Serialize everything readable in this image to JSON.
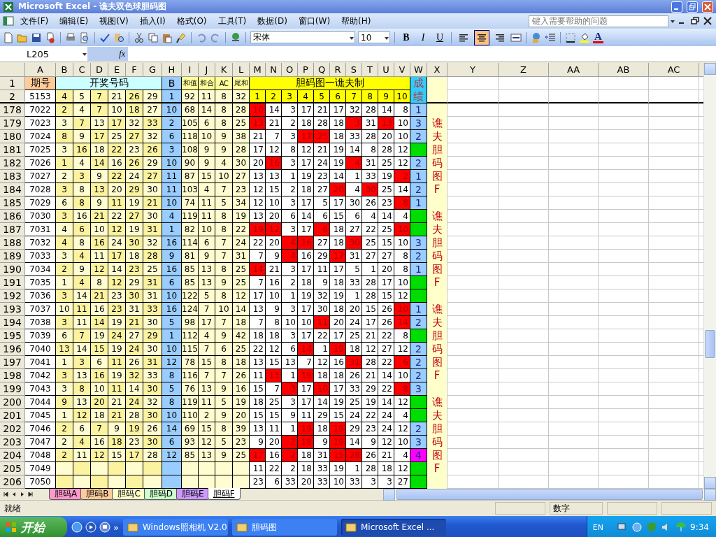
{
  "window": {
    "title": "Microsoft Excel - 谯夫双色球胆码图"
  },
  "menus": [
    "文件(F)",
    "编辑(E)",
    "视图(V)",
    "插入(I)",
    "格式(O)",
    "工具(T)",
    "数据(D)",
    "窗口(W)",
    "帮助(H)"
  ],
  "help_box": {
    "placeholder": "键入需要帮助的问题"
  },
  "formatting": {
    "font": "宋体",
    "size": "10",
    "bold": "B",
    "italic": "I",
    "underline": "U",
    "font_color": "A",
    "alignment": [
      {
        "kind": "left",
        "selected": false
      },
      {
        "kind": "center",
        "selected": true
      },
      {
        "kind": "right",
        "selected": false
      }
    ]
  },
  "formula_bar": {
    "name_box": "L205",
    "fx": "fx"
  },
  "columns": [
    "A",
    "B",
    "C",
    "D",
    "E",
    "F",
    "G",
    "H",
    "I",
    "J",
    "K",
    "L",
    "M",
    "N",
    "O",
    "P",
    "Q",
    "R",
    "S",
    "T",
    "U",
    "V",
    "W",
    "X",
    "Y",
    "Z",
    "AA",
    "AB",
    "AC"
  ],
  "header": {
    "row": "1",
    "period": "期号",
    "numbers": "开奖号码",
    "blue": "B",
    "stats": [
      "和值",
      "和合",
      "AC",
      "尾和"
    ],
    "grid_title": "胆码图一谯夫制",
    "score": "成绩"
  },
  "first_row": {
    "row": "2",
    "period": "5153",
    "balls": [
      "4",
      "5",
      "7",
      "21",
      "26",
      "29"
    ],
    "blue": "1",
    "stats": [
      "92",
      "11",
      "8",
      "32"
    ],
    "grid": [
      "1",
      "2",
      "3",
      "4",
      "5",
      "6",
      "7",
      "8",
      "9",
      "10"
    ]
  },
  "rows": [
    {
      "row": "178",
      "period": "7022",
      "balls": [
        "2",
        "4",
        "7",
        "10",
        "18",
        "27"
      ],
      "blue": "10",
      "stats": [
        "68",
        "14",
        "8",
        "28"
      ],
      "grid": [
        {
          "value": "10",
          "hit": true
        },
        {
          "value": "14",
          "hit": false
        },
        {
          "value": "3",
          "hit": false
        },
        {
          "value": "17",
          "hit": false
        },
        {
          "value": "21",
          "hit": false
        },
        {
          "value": "17",
          "hit": false
        },
        {
          "value": "32",
          "hit": false
        },
        {
          "value": "28",
          "hit": false
        },
        {
          "value": "14",
          "hit": false
        },
        {
          "value": "8",
          "hit": false
        }
      ],
      "score": "1",
      "color": "#99ccff"
    },
    {
      "row": "179",
      "period": "7023",
      "balls": [
        "3",
        "7",
        "13",
        "17",
        "32",
        "33"
      ],
      "blue": "2",
      "stats": [
        "105",
        "6",
        "8",
        "25"
      ],
      "grid": [
        {
          "value": "13",
          "hit": true
        },
        {
          "value": "21",
          "hit": false
        },
        {
          "value": "2",
          "hit": false
        },
        {
          "value": "18",
          "hit": false
        },
        {
          "value": "28",
          "hit": false
        },
        {
          "value": "18",
          "hit": false
        },
        {
          "value": "3",
          "hit": true
        },
        {
          "value": "31",
          "hit": false
        },
        {
          "value": "13",
          "hit": true
        },
        {
          "value": "10",
          "hit": false
        }
      ],
      "score": "3",
      "color": "#99ccff",
      "note": "谯夫胆码图F"
    },
    {
      "row": "180",
      "period": "7024",
      "balls": [
        "8",
        "9",
        "17",
        "25",
        "27",
        "32"
      ],
      "blue": "6",
      "stats": [
        "118",
        "10",
        "9",
        "38"
      ],
      "grid": [
        {
          "value": "21",
          "hit": false
        },
        {
          "value": "7",
          "hit": false
        },
        {
          "value": "3",
          "hit": false
        },
        {
          "value": "17",
          "hit": true
        },
        {
          "value": "25",
          "hit": true
        },
        {
          "value": "18",
          "hit": false
        },
        {
          "value": "33",
          "hit": false
        },
        {
          "value": "28",
          "hit": false
        },
        {
          "value": "20",
          "hit": false
        },
        {
          "value": "10",
          "hit": false
        }
      ],
      "score": "2",
      "color": "#99ccff"
    },
    {
      "row": "181",
      "period": "7025",
      "balls": [
        "3",
        "16",
        "18",
        "22",
        "23",
        "26"
      ],
      "blue": "3",
      "stats": [
        "108",
        "9",
        "9",
        "28"
      ],
      "grid": [
        {
          "value": "17",
          "hit": false
        },
        {
          "value": "12",
          "hit": false
        },
        {
          "value": "8",
          "hit": false
        },
        {
          "value": "12",
          "hit": false
        },
        {
          "value": "21",
          "hit": false
        },
        {
          "value": "19",
          "hit": false
        },
        {
          "value": "14",
          "hit": false
        },
        {
          "value": "8",
          "hit": false
        },
        {
          "value": "28",
          "hit": false
        },
        {
          "value": "12",
          "hit": false
        }
      ],
      "color": "#00dd00"
    },
    {
      "row": "182",
      "period": "7026",
      "balls": [
        "1",
        "4",
        "14",
        "16",
        "26",
        "29"
      ],
      "blue": "10",
      "stats": [
        "90",
        "9",
        "4",
        "30"
      ],
      "grid": [
        {
          "value": "20",
          "hit": false
        },
        {
          "value": "16",
          "hit": true
        },
        {
          "value": "3",
          "hit": false
        },
        {
          "value": "17",
          "hit": false
        },
        {
          "value": "24",
          "hit": false
        },
        {
          "value": "19",
          "hit": false
        },
        {
          "value": "4",
          "hit": true
        },
        {
          "value": "31",
          "hit": false
        },
        {
          "value": "25",
          "hit": false
        },
        {
          "value": "12",
          "hit": false
        }
      ],
      "score": "2",
      "color": "#99ccff"
    },
    {
      "row": "183",
      "period": "7027",
      "balls": [
        "2",
        "3",
        "9",
        "22",
        "24",
        "27"
      ],
      "blue": "11",
      "stats": [
        "87",
        "15",
        "10",
        "27"
      ],
      "grid": [
        {
          "value": "13",
          "hit": false
        },
        {
          "value": "13",
          "hit": false
        },
        {
          "value": "1",
          "hit": false
        },
        {
          "value": "19",
          "hit": false
        },
        {
          "value": "23",
          "hit": false
        },
        {
          "value": "14",
          "hit": false
        },
        {
          "value": "1",
          "hit": false
        },
        {
          "value": "33",
          "hit": false
        },
        {
          "value": "19",
          "hit": false
        },
        {
          "value": "2",
          "hit": true
        }
      ],
      "score": "1",
      "color": "#99ccff"
    },
    {
      "row": "184",
      "period": "7028",
      "balls": [
        "3",
        "8",
        "13",
        "20",
        "29",
        "30"
      ],
      "blue": "11",
      "stats": [
        "103",
        "4",
        "7",
        "23"
      ],
      "grid": [
        {
          "value": "12",
          "hit": false
        },
        {
          "value": "15",
          "hit": false
        },
        {
          "value": "2",
          "hit": false
        },
        {
          "value": "18",
          "hit": false
        },
        {
          "value": "27",
          "hit": false
        },
        {
          "value": "20",
          "hit": true
        },
        {
          "value": "4",
          "hit": false
        },
        {
          "value": "30",
          "hit": true
        },
        {
          "value": "25",
          "hit": false
        },
        {
          "value": "14",
          "hit": false
        }
      ],
      "score": "2",
      "color": "#99ccff"
    },
    {
      "row": "185",
      "period": "7029",
      "balls": [
        "6",
        "8",
        "9",
        "11",
        "19",
        "21"
      ],
      "blue": "10",
      "stats": [
        "74",
        "11",
        "5",
        "34"
      ],
      "grid": [
        {
          "value": "12",
          "hit": false
        },
        {
          "value": "10",
          "hit": false
        },
        {
          "value": "3",
          "hit": false
        },
        {
          "value": "17",
          "hit": false
        },
        {
          "value": "5",
          "hit": false
        },
        {
          "value": "17",
          "hit": false
        },
        {
          "value": "30",
          "hit": false
        },
        {
          "value": "26",
          "hit": false
        },
        {
          "value": "23",
          "hit": false
        },
        {
          "value": "8",
          "hit": true
        }
      ],
      "score": "1",
      "color": "#99ccff"
    },
    {
      "row": "186",
      "period": "7030",
      "balls": [
        "3",
        "16",
        "21",
        "22",
        "27",
        "30"
      ],
      "blue": "4",
      "stats": [
        "119",
        "11",
        "8",
        "19"
      ],
      "grid": [
        {
          "value": "13",
          "hit": false
        },
        {
          "value": "20",
          "hit": false
        },
        {
          "value": "6",
          "hit": false
        },
        {
          "value": "14",
          "hit": false
        },
        {
          "value": "6",
          "hit": false
        },
        {
          "value": "15",
          "hit": false
        },
        {
          "value": "6",
          "hit": false
        },
        {
          "value": "4",
          "hit": false
        },
        {
          "value": "14",
          "hit": false
        },
        {
          "value": "4",
          "hit": false
        }
      ],
      "color": "#00dd00",
      "note": "谯夫胆码图F"
    },
    {
      "row": "187",
      "period": "7031",
      "balls": [
        "4",
        "6",
        "10",
        "12",
        "19",
        "31"
      ],
      "blue": "1",
      "stats": [
        "82",
        "10",
        "8",
        "22"
      ],
      "grid": [
        {
          "value": "19",
          "hit": true
        },
        {
          "value": "12",
          "hit": true
        },
        {
          "value": "3",
          "hit": false
        },
        {
          "value": "17",
          "hit": false
        },
        {
          "value": "6",
          "hit": true
        },
        {
          "value": "18",
          "hit": false
        },
        {
          "value": "27",
          "hit": false
        },
        {
          "value": "22",
          "hit": false
        },
        {
          "value": "25",
          "hit": false
        },
        {
          "value": "10",
          "hit": true
        }
      ],
      "color": "#00dd00"
    },
    {
      "row": "188",
      "period": "7032",
      "balls": [
        "4",
        "8",
        "16",
        "24",
        "30",
        "32"
      ],
      "blue": "16",
      "stats": [
        "114",
        "6",
        "7",
        "24"
      ],
      "grid": [
        {
          "value": "22",
          "hit": false
        },
        {
          "value": "20",
          "hit": false
        },
        {
          "value": "4",
          "hit": true
        },
        {
          "value": "16",
          "hit": true
        },
        {
          "value": "27",
          "hit": false
        },
        {
          "value": "18",
          "hit": false
        },
        {
          "value": "30",
          "hit": true
        },
        {
          "value": "25",
          "hit": false
        },
        {
          "value": "15",
          "hit": false
        },
        {
          "value": "10",
          "hit": false
        }
      ],
      "score": "3",
      "color": "#99ccff"
    },
    {
      "row": "189",
      "period": "7033",
      "balls": [
        "3",
        "4",
        "11",
        "17",
        "18",
        "28"
      ],
      "blue": "9",
      "stats": [
        "81",
        "9",
        "7",
        "31"
      ],
      "grid": [
        {
          "value": "7",
          "hit": false
        },
        {
          "value": "9",
          "hit": false
        },
        {
          "value": "4",
          "hit": true
        },
        {
          "value": "16",
          "hit": false
        },
        {
          "value": "29",
          "hit": false
        },
        {
          "value": "17",
          "hit": true
        },
        {
          "value": "31",
          "hit": false
        },
        {
          "value": "27",
          "hit": false
        },
        {
          "value": "27",
          "hit": false
        },
        {
          "value": "8",
          "hit": false
        }
      ],
      "score": "2",
      "color": "#99ccff"
    },
    {
      "row": "190",
      "period": "7034",
      "balls": [
        "2",
        "9",
        "12",
        "14",
        "23",
        "25"
      ],
      "blue": "16",
      "stats": [
        "85",
        "13",
        "8",
        "25"
      ],
      "grid": [
        {
          "value": "14",
          "hit": true
        },
        {
          "value": "21",
          "hit": false
        },
        {
          "value": "3",
          "hit": false
        },
        {
          "value": "17",
          "hit": false
        },
        {
          "value": "11",
          "hit": false
        },
        {
          "value": "17",
          "hit": false
        },
        {
          "value": "5",
          "hit": false
        },
        {
          "value": "1",
          "hit": false
        },
        {
          "value": "20",
          "hit": false
        },
        {
          "value": "8",
          "hit": false
        }
      ],
      "score": "1",
      "color": "#99ccff"
    },
    {
      "row": "191",
      "period": "7035",
      "balls": [
        "1",
        "4",
        "8",
        "12",
        "29",
        "31"
      ],
      "blue": "6",
      "stats": [
        "85",
        "13",
        "9",
        "25"
      ],
      "grid": [
        {
          "value": "7",
          "hit": false
        },
        {
          "value": "16",
          "hit": false
        },
        {
          "value": "2",
          "hit": false
        },
        {
          "value": "18",
          "hit": false
        },
        {
          "value": "9",
          "hit": false
        },
        {
          "value": "18",
          "hit": false
        },
        {
          "value": "33",
          "hit": false
        },
        {
          "value": "28",
          "hit": false
        },
        {
          "value": "17",
          "hit": false
        },
        {
          "value": "10",
          "hit": false
        }
      ],
      "color": "#00dd00"
    },
    {
      "row": "192",
      "period": "7036",
      "balls": [
        "3",
        "14",
        "21",
        "23",
        "30",
        "31"
      ],
      "blue": "10",
      "stats": [
        "122",
        "5",
        "8",
        "12"
      ],
      "grid": [
        {
          "value": "17",
          "hit": false
        },
        {
          "value": "10",
          "hit": false
        },
        {
          "value": "1",
          "hit": false
        },
        {
          "value": "19",
          "hit": false
        },
        {
          "value": "32",
          "hit": false
        },
        {
          "value": "19",
          "hit": false
        },
        {
          "value": "1",
          "hit": false
        },
        {
          "value": "28",
          "hit": false
        },
        {
          "value": "15",
          "hit": false
        },
        {
          "value": "12",
          "hit": false
        }
      ],
      "color": "#00dd00"
    },
    {
      "row": "193",
      "period": "7037",
      "balls": [
        "10",
        "11",
        "16",
        "23",
        "31",
        "33"
      ],
      "blue": "16",
      "stats": [
        "124",
        "7",
        "10",
        "14"
      ],
      "grid": [
        {
          "value": "13",
          "hit": false
        },
        {
          "value": "9",
          "hit": false
        },
        {
          "value": "3",
          "hit": false
        },
        {
          "value": "17",
          "hit": false
        },
        {
          "value": "30",
          "hit": false
        },
        {
          "value": "18",
          "hit": false
        },
        {
          "value": "20",
          "hit": false
        },
        {
          "value": "15",
          "hit": false
        },
        {
          "value": "26",
          "hit": false
        },
        {
          "value": "10",
          "hit": true
        }
      ],
      "score": "1",
      "color": "#99ccff",
      "note": "谯夫胆码图F"
    },
    {
      "row": "194",
      "period": "7038",
      "balls": [
        "3",
        "11",
        "14",
        "19",
        "21",
        "30"
      ],
      "blue": "5",
      "stats": [
        "98",
        "17",
        "7",
        "18"
      ],
      "grid": [
        {
          "value": "7",
          "hit": false
        },
        {
          "value": "8",
          "hit": false
        },
        {
          "value": "10",
          "hit": false
        },
        {
          "value": "10",
          "hit": false
        },
        {
          "value": "11",
          "hit": true
        },
        {
          "value": "20",
          "hit": false
        },
        {
          "value": "24",
          "hit": false
        },
        {
          "value": "17",
          "hit": false
        },
        {
          "value": "26",
          "hit": false
        },
        {
          "value": "14",
          "hit": true
        }
      ],
      "score": "2",
      "color": "#99ccff"
    },
    {
      "row": "195",
      "period": "7039",
      "balls": [
        "6",
        "7",
        "19",
        "24",
        "27",
        "29"
      ],
      "blue": "1",
      "stats": [
        "112",
        "4",
        "9",
        "42"
      ],
      "grid": [
        {
          "value": "18",
          "hit": false
        },
        {
          "value": "18",
          "hit": false
        },
        {
          "value": "3",
          "hit": false
        },
        {
          "value": "17",
          "hit": false
        },
        {
          "value": "22",
          "hit": false
        },
        {
          "value": "17",
          "hit": false
        },
        {
          "value": "25",
          "hit": false
        },
        {
          "value": "21",
          "hit": false
        },
        {
          "value": "22",
          "hit": false
        },
        {
          "value": "8",
          "hit": false
        }
      ],
      "color": "#00dd00"
    },
    {
      "row": "196",
      "period": "7040",
      "balls": [
        "13",
        "14",
        "15",
        "19",
        "24",
        "30"
      ],
      "blue": "10",
      "stats": [
        "115",
        "7",
        "6",
        "25"
      ],
      "grid": [
        {
          "value": "22",
          "hit": false
        },
        {
          "value": "12",
          "hit": false
        },
        {
          "value": "6",
          "hit": false
        },
        {
          "value": "14",
          "hit": true
        },
        {
          "value": "1",
          "hit": false
        },
        {
          "value": "19",
          "hit": true
        },
        {
          "value": "18",
          "hit": false
        },
        {
          "value": "12",
          "hit": false
        },
        {
          "value": "27",
          "hit": false
        },
        {
          "value": "12",
          "hit": false
        }
      ],
      "score": "2",
      "color": "#99ccff"
    },
    {
      "row": "197",
      "period": "7041",
      "balls": [
        "1",
        "3",
        "6",
        "11",
        "26",
        "31"
      ],
      "blue": "12",
      "stats": [
        "78",
        "15",
        "8",
        "18"
      ],
      "grid": [
        {
          "value": "13",
          "hit": false
        },
        {
          "value": "15",
          "hit": false
        },
        {
          "value": "13",
          "hit": false
        },
        {
          "value": "7",
          "hit": false
        },
        {
          "value": "12",
          "hit": false
        },
        {
          "value": "16",
          "hit": false
        },
        {
          "value": "31",
          "hit": true
        },
        {
          "value": "28",
          "hit": false
        },
        {
          "value": "22",
          "hit": false
        },
        {
          "value": "6",
          "hit": true
        }
      ],
      "score": "2",
      "color": "#99ccff"
    },
    {
      "row": "198",
      "period": "7042",
      "balls": [
        "3",
        "13",
        "16",
        "19",
        "32",
        "33"
      ],
      "blue": "8",
      "stats": [
        "116",
        "7",
        "7",
        "26"
      ],
      "grid": [
        {
          "value": "11",
          "hit": false
        },
        {
          "value": "13",
          "hit": true
        },
        {
          "value": "1",
          "hit": false
        },
        {
          "value": "19",
          "hit": true
        },
        {
          "value": "18",
          "hit": false
        },
        {
          "value": "18",
          "hit": false
        },
        {
          "value": "26",
          "hit": false
        },
        {
          "value": "21",
          "hit": false
        },
        {
          "value": "14",
          "hit": false
        },
        {
          "value": "10",
          "hit": false
        }
      ],
      "score": "2",
      "color": "#99ccff"
    },
    {
      "row": "199",
      "period": "7043",
      "balls": [
        "3",
        "8",
        "10",
        "11",
        "14",
        "30"
      ],
      "blue": "5",
      "stats": [
        "76",
        "13",
        "9",
        "16"
      ],
      "grid": [
        {
          "value": "15",
          "hit": false
        },
        {
          "value": "7",
          "hit": false
        },
        {
          "value": "3",
          "hit": true
        },
        {
          "value": "17",
          "hit": false
        },
        {
          "value": "10",
          "hit": true
        },
        {
          "value": "17",
          "hit": false
        },
        {
          "value": "33",
          "hit": false
        },
        {
          "value": "29",
          "hit": false
        },
        {
          "value": "22",
          "hit": false
        },
        {
          "value": "8",
          "hit": true
        }
      ],
      "score": "3",
      "color": "#99ccff"
    },
    {
      "row": "200",
      "period": "7044",
      "balls": [
        "9",
        "13",
        "20",
        "21",
        "24",
        "32"
      ],
      "blue": "8",
      "stats": [
        "119",
        "11",
        "5",
        "19"
      ],
      "grid": [
        {
          "value": "18",
          "hit": false
        },
        {
          "value": "25",
          "hit": false
        },
        {
          "value": "3",
          "hit": false
        },
        {
          "value": "17",
          "hit": false
        },
        {
          "value": "14",
          "hit": false
        },
        {
          "value": "19",
          "hit": false
        },
        {
          "value": "25",
          "hit": false
        },
        {
          "value": "19",
          "hit": false
        },
        {
          "value": "14",
          "hit": false
        },
        {
          "value": "12",
          "hit": false
        }
      ],
      "color": "#00dd00",
      "note": "谯夫胆码图F"
    },
    {
      "row": "201",
      "period": "7045",
      "balls": [
        "1",
        "12",
        "18",
        "21",
        "28",
        "30"
      ],
      "blue": "10",
      "stats": [
        "110",
        "2",
        "9",
        "20"
      ],
      "grid": [
        {
          "value": "15",
          "hit": false
        },
        {
          "value": "15",
          "hit": false
        },
        {
          "value": "9",
          "hit": false
        },
        {
          "value": "11",
          "hit": false
        },
        {
          "value": "29",
          "hit": false
        },
        {
          "value": "15",
          "hit": false
        },
        {
          "value": "24",
          "hit": false
        },
        {
          "value": "22",
          "hit": false
        },
        {
          "value": "24",
          "hit": false
        },
        {
          "value": "4",
          "hit": false
        }
      ],
      "color": "#00dd00"
    },
    {
      "row": "202",
      "period": "7046",
      "balls": [
        "2",
        "6",
        "7",
        "9",
        "19",
        "26"
      ],
      "blue": "14",
      "stats": [
        "69",
        "15",
        "8",
        "39"
      ],
      "grid": [
        {
          "value": "13",
          "hit": false
        },
        {
          "value": "11",
          "hit": false
        },
        {
          "value": "1",
          "hit": false
        },
        {
          "value": "19",
          "hit": true
        },
        {
          "value": "18",
          "hit": false
        },
        {
          "value": "19",
          "hit": true
        },
        {
          "value": "29",
          "hit": false
        },
        {
          "value": "23",
          "hit": false
        },
        {
          "value": "24",
          "hit": false
        },
        {
          "value": "12",
          "hit": false
        }
      ],
      "score": "2",
      "color": "#99ccff"
    },
    {
      "row": "203",
      "period": "7047",
      "balls": [
        "2",
        "4",
        "16",
        "18",
        "23",
        "30"
      ],
      "blue": "6",
      "stats": [
        "93",
        "12",
        "5",
        "23"
      ],
      "grid": [
        {
          "value": "9",
          "hit": false
        },
        {
          "value": "20",
          "hit": false
        },
        {
          "value": "2",
          "hit": true
        },
        {
          "value": "18",
          "hit": true
        },
        {
          "value": "9",
          "hit": false
        },
        {
          "value": "19",
          "hit": true
        },
        {
          "value": "14",
          "hit": false
        },
        {
          "value": "9",
          "hit": false
        },
        {
          "value": "12",
          "hit": false
        },
        {
          "value": "10",
          "hit": false
        }
      ],
      "score": "3",
      "color": "#99ccff"
    },
    {
      "row": "204",
      "period": "7048",
      "balls": [
        "2",
        "11",
        "12",
        "15",
        "17",
        "28"
      ],
      "blue": "12",
      "stats": [
        "85",
        "13",
        "9",
        "25"
      ],
      "grid": [
        {
          "value": "17",
          "hit": true
        },
        {
          "value": "16",
          "hit": false
        },
        {
          "value": "2",
          "hit": true
        },
        {
          "value": "18",
          "hit": false
        },
        {
          "value": "31",
          "hit": false
        },
        {
          "value": "15",
          "hit": true
        },
        {
          "value": "28",
          "hit": true
        },
        {
          "value": "26",
          "hit": false
        },
        {
          "value": "21",
          "hit": false
        },
        {
          "value": "4",
          "hit": false
        }
      ],
      "score": "4",
      "color": "#ff00ff"
    },
    {
      "row": "205",
      "period": "7049",
      "grid": [
        {
          "value": "11",
          "hit": false
        },
        {
          "value": "22",
          "hit": false
        },
        {
          "value": "2",
          "hit": false
        },
        {
          "value": "18",
          "hit": false
        },
        {
          "value": "33",
          "hit": false
        },
        {
          "value": "19",
          "hit": false
        },
        {
          "value": "1",
          "hit": false
        },
        {
          "value": "28",
          "hit": false
        },
        {
          "value": "18",
          "hit": false
        },
        {
          "value": "12",
          "hit": false
        }
      ],
      "color": "#00dd00"
    },
    {
      "row": "206",
      "period": "7050",
      "grid": [
        {
          "value": "23",
          "hit": false
        },
        {
          "value": "6",
          "hit": false
        },
        {
          "value": "33",
          "hit": false
        },
        {
          "value": "20",
          "hit": false
        },
        {
          "value": "33",
          "hit": false
        },
        {
          "value": "10",
          "hit": false
        },
        {
          "value": "33",
          "hit": false
        },
        {
          "value": "3",
          "hit": false
        },
        {
          "value": "3",
          "hit": false
        },
        {
          "value": "27",
          "hit": false
        }
      ],
      "color": "#00dd00"
    }
  ],
  "sheet_tabs": [
    {
      "label": "胆码A",
      "color": "#ff99cc",
      "selected": false
    },
    {
      "label": "胆码B",
      "color": "#ffcc99",
      "selected": false
    },
    {
      "label": "胆码C",
      "color": "#ffffcc",
      "selected": false
    },
    {
      "label": "胆码D",
      "color": "#ccffcc",
      "selected": false
    },
    {
      "label": "胆码E",
      "color": "#cc99ff",
      "selected": false
    },
    {
      "label": "胆码F",
      "color": "#ffffff",
      "selected": true
    }
  ],
  "status_bar": {
    "status": "就绪",
    "mode": "数字"
  },
  "taskbar": {
    "start": "开始",
    "more": "»",
    "tasks": [
      {
        "label": "Windows照相机 V2.0",
        "selected": false
      },
      {
        "label": "胆码图",
        "selected": false
      },
      {
        "label": "Microsoft Excel ...",
        "selected": true
      }
    ],
    "language": "EN",
    "clock": "9:34"
  }
}
